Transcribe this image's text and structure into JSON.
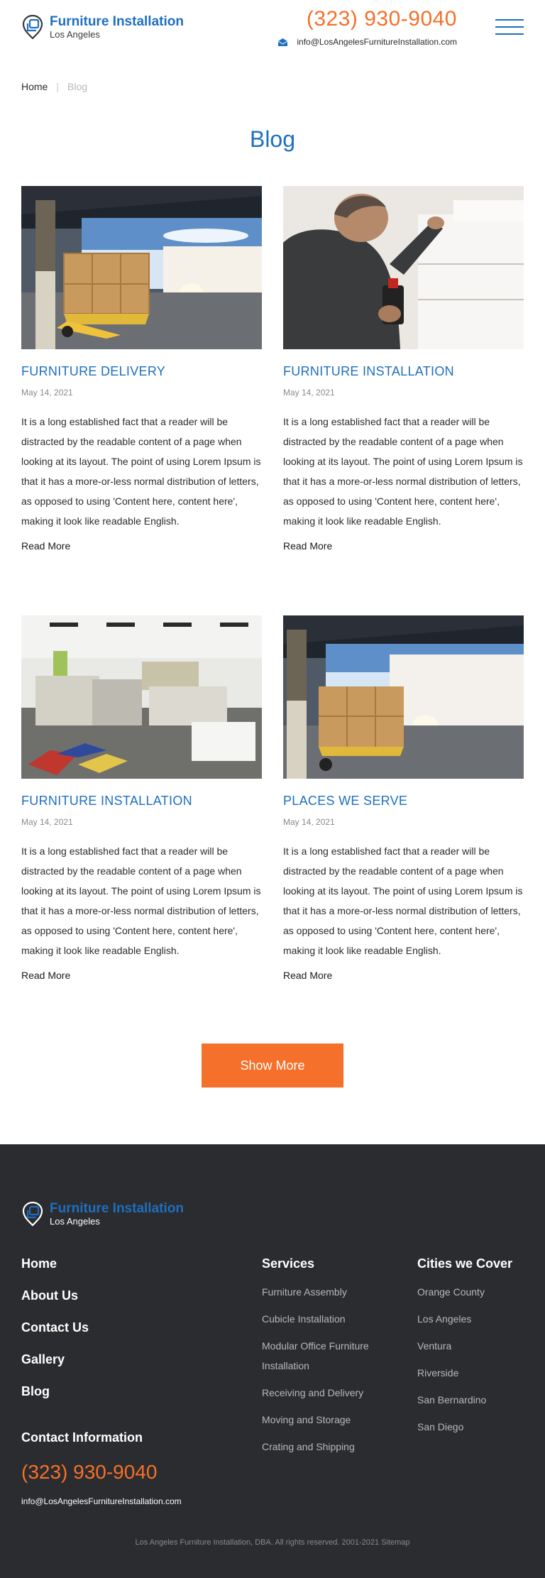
{
  "header": {
    "brand": "Furniture Installation",
    "city": "Los Angeles",
    "phone": "(323) 930-9040",
    "email": "info@LosAngelesFurnitureInstallation.com",
    "menu_icon": "hamburger-menu-icon"
  },
  "breadcrumb": {
    "home": "Home",
    "separator": "|",
    "current": "Blog"
  },
  "page_title": "Blog",
  "posts": [
    {
      "title": "FURNITURE DELIVERY",
      "date": "May 14, 2021",
      "excerpt": "It is a long established fact that a reader will be distracted by the readable content of a page when looking at its layout. The point of using Lorem Ipsum is that it has a more-or-less normal distribution of letters, as opposed to using 'Content here, content here', making it look like readable English.",
      "read_more": "Read More",
      "image": "pallet-jack-delivery-photo"
    },
    {
      "title": "FURNITURE INSTALLATION",
      "date": "May 14, 2021",
      "excerpt": "It is a long established fact that a reader will be distracted by the readable content of a page when looking at its layout. The point of using Lorem Ipsum is that it has a more-or-less normal distribution of letters, as opposed to using 'Content here, content here', making it look like readable English.",
      "read_more": "Read More",
      "image": "man-installing-cabinet-photo"
    },
    {
      "title": "FURNITURE INSTALLATION",
      "date": "May 14, 2021",
      "excerpt": "It is a long established fact that a reader will be distracted by the readable content of a page when looking at its layout. The point of using Lorem Ipsum is that it has a more-or-less normal distribution of letters, as opposed to using 'Content here, content here', making it look like readable English.",
      "read_more": "Read More",
      "image": "office-cubicles-photo"
    },
    {
      "title": "PLACES WE SERVE",
      "date": "May 14, 2021",
      "excerpt": "It is a long established fact that a reader will be distracted by the readable content of a page when looking at its layout. The point of using Lorem Ipsum is that it has a more-or-less normal distribution of letters, as opposed to using 'Content here, content here', making it look like readable English.",
      "read_more": "Read More",
      "image": "pallet-jack-delivery-photo"
    }
  ],
  "show_more": "Show More",
  "footer": {
    "brand": "Furniture Installation",
    "city": "Los Angeles",
    "nav": [
      "Home",
      "About Us",
      "Contact Us",
      "Gallery",
      "Blog"
    ],
    "services_title": "Services",
    "services": [
      "Furniture Assembly",
      "Cubicle Installation",
      "Modular Office Furniture Installation",
      "Receiving and Delivery",
      "Moving and Storage",
      "Crating and Shipping"
    ],
    "cities_title": "Cities we Cover",
    "cities": [
      "Orange County",
      "Los Angeles",
      "Ventura",
      "Riverside",
      "San Bernardino",
      "San Diego"
    ],
    "contact_title": "Contact Information",
    "phone": "(323) 930-9040",
    "email": "info@LosAngelesFurnitureInstallation.com",
    "copyright": "Los Angeles Furniture Installation, DBA. All rights reserved. 2001-2021 Sitemap"
  },
  "colors": {
    "brand_blue": "#1e6fc0",
    "accent_orange": "#f5702a",
    "footer_bg": "#2b2c2f"
  }
}
